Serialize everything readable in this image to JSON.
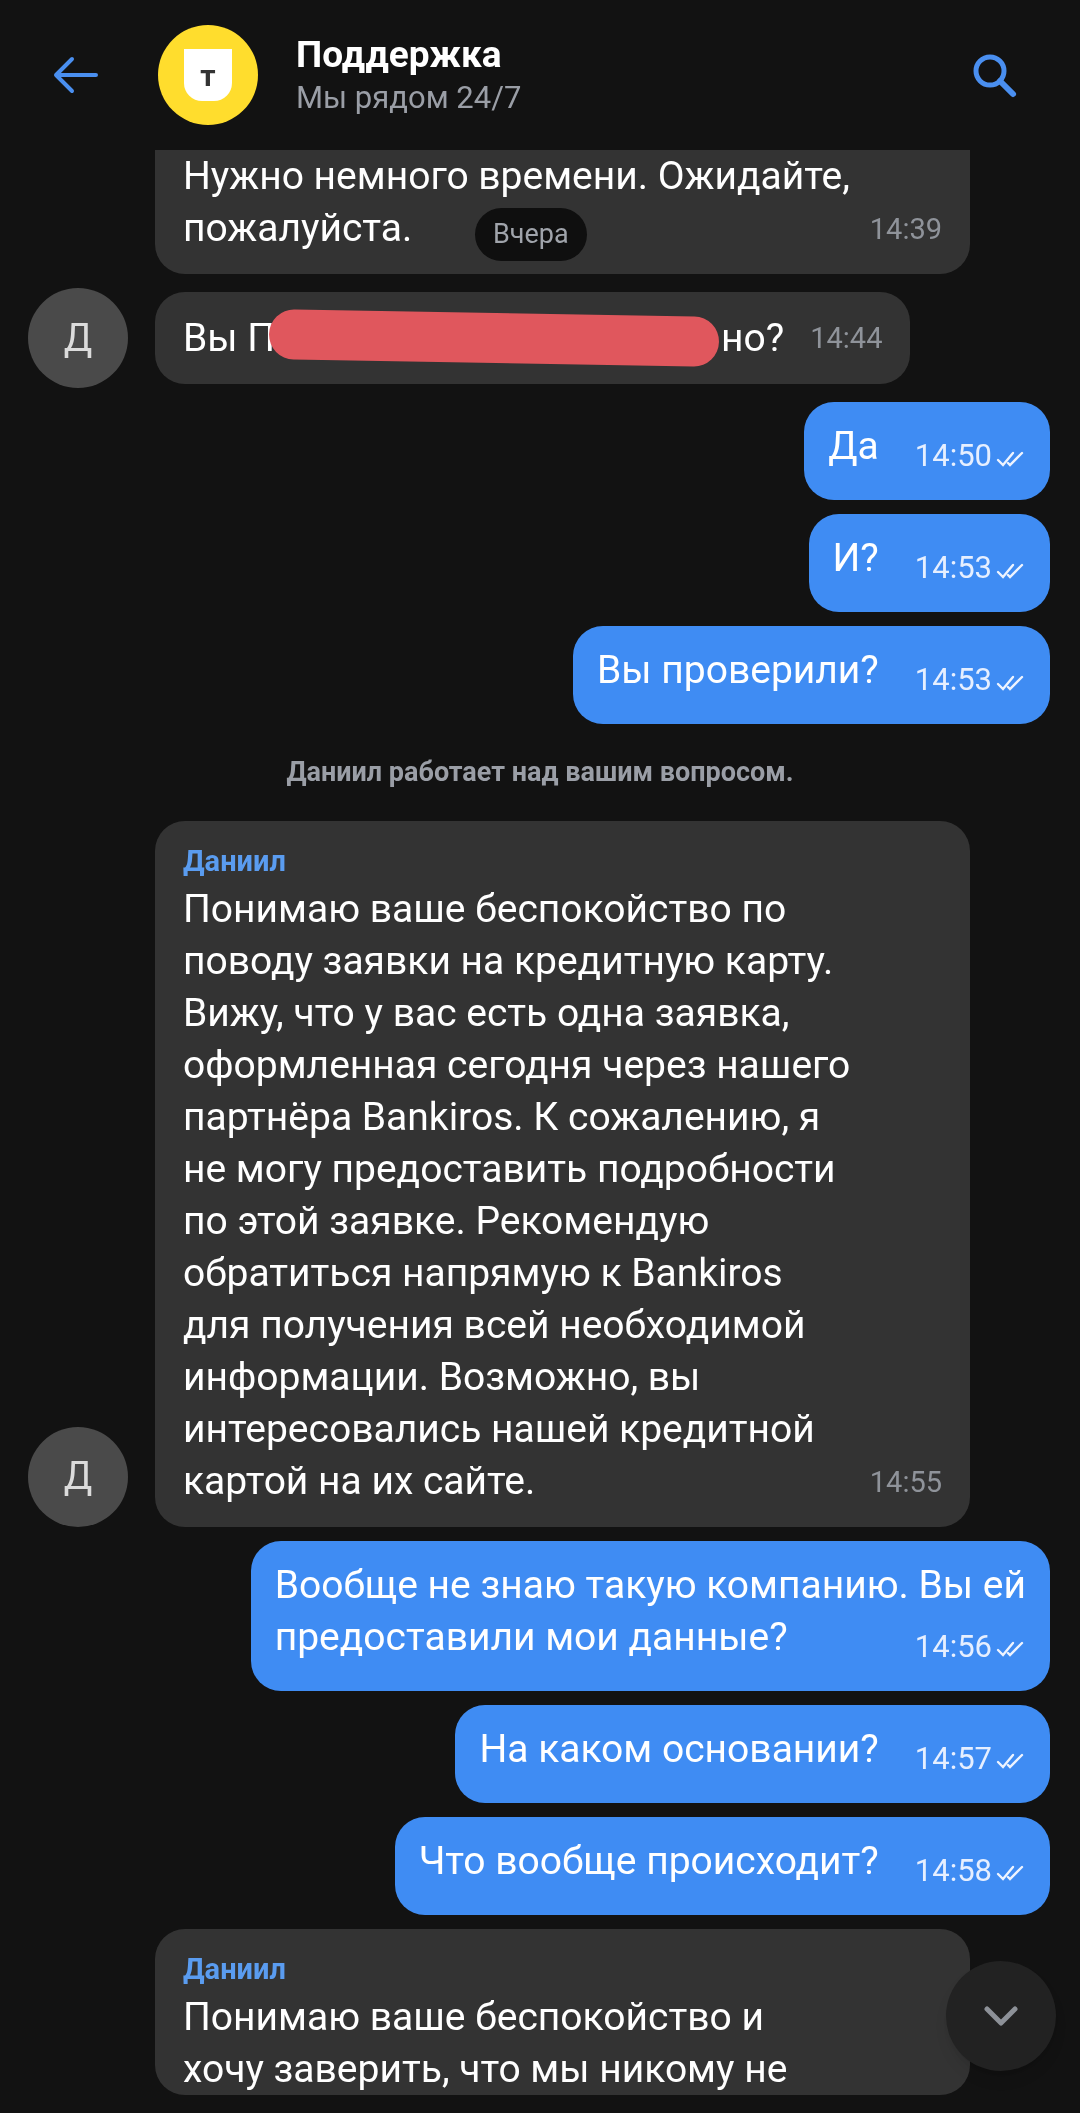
{
  "header": {
    "title": "Поддержка",
    "subtitle": "Мы рядом 24/7",
    "logo_letter": "т"
  },
  "date_pill": "Вчера",
  "messages": [
    {
      "kind": "incoming",
      "lines": [
        "Нужно немного времени. Ожидайте,",
        "пожалуйста."
      ],
      "time": "14:39",
      "cut_top": true
    },
    {
      "kind": "redacted",
      "avatar": "Д",
      "text": "Вы П",
      "text_after": "но?",
      "time": "14:44"
    },
    {
      "kind": "outgoing",
      "lines": [
        "Да"
      ],
      "time": "14:50",
      "read": true
    },
    {
      "kind": "outgoing",
      "lines": [
        "И?"
      ],
      "time": "14:53",
      "read": true
    },
    {
      "kind": "outgoing",
      "lines": [
        "Вы проверили?"
      ],
      "time": "14:53",
      "read": true
    },
    {
      "kind": "system",
      "text": "Даниил работает над вашим вопросом."
    },
    {
      "kind": "incoming",
      "avatar": "Д",
      "sender": "Даниил",
      "lines": [
        "Понимаю ваше беспокойство по",
        "поводу заявки на кредитную карту.",
        "Вижу, что у вас есть одна заявка,",
        "оформленная сегодня через нашего",
        "партнёра Bankiros. К сожалению, я",
        "не могу предоставить подробности",
        "по этой заявке. Рекомендую",
        "обратиться напрямую к Bankiros",
        "для получения всей необходимой",
        "информации. Возможно, вы",
        "интересовались нашей кредитной",
        "картой на их сайте."
      ],
      "time": "14:55"
    },
    {
      "kind": "outgoing",
      "lines": [
        "Вообще не знаю такую компанию. Вы ей",
        "предоставили мои данные?"
      ],
      "time": "14:56",
      "read": true
    },
    {
      "kind": "outgoing",
      "lines": [
        "На каком основании?"
      ],
      "time": "14:57",
      "read": true
    },
    {
      "kind": "outgoing",
      "lines": [
        "Что вообще происходит?"
      ],
      "time": "14:58",
      "read": true
    },
    {
      "kind": "incoming",
      "sender": "Даниил",
      "lines": [
        "Понимаю ваше беспокойство и",
        "хочу заверить, что мы никому не"
      ]
    }
  ]
}
